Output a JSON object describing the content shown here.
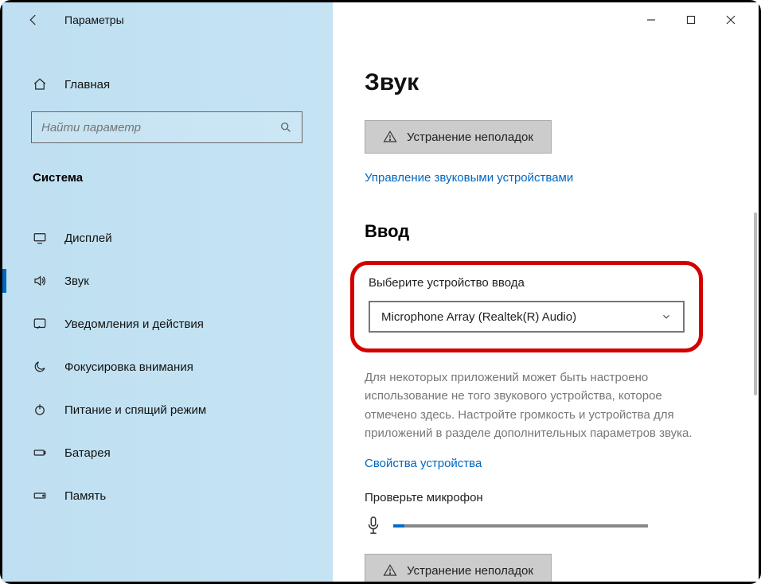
{
  "titlebar": {
    "app_title": "Параметры"
  },
  "sidebar": {
    "home_label": "Главная",
    "search_placeholder": "Найти параметр",
    "category": "Система",
    "items": [
      {
        "label": "Дисплей",
        "key": "display"
      },
      {
        "label": "Звук",
        "key": "sound"
      },
      {
        "label": "Уведомления и действия",
        "key": "notifications"
      },
      {
        "label": "Фокусировка внимания",
        "key": "focus"
      },
      {
        "label": "Питание и спящий режим",
        "key": "power"
      },
      {
        "label": "Батарея",
        "key": "battery"
      },
      {
        "label": "Память",
        "key": "storage"
      }
    ]
  },
  "main": {
    "page_heading": "Звук",
    "troubleshoot_label": "Устранение неполадок",
    "manage_devices_link": "Управление звуковыми устройствами",
    "input_section_heading": "Ввод",
    "input_device_label": "Выберите устройство ввода",
    "input_device_value": "Microphone Array (Realtek(R) Audio)",
    "input_description": "Для некоторых приложений может быть настроено использование не того звукового устройства, которое отмечено здесь. Настройте громкость и устройства для приложений в разделе дополнительных параметров звука.",
    "device_properties_link": "Свойства устройства",
    "test_mic_label": "Проверьте микрофон",
    "troubleshoot_label_2": "Устранение неполадок"
  }
}
